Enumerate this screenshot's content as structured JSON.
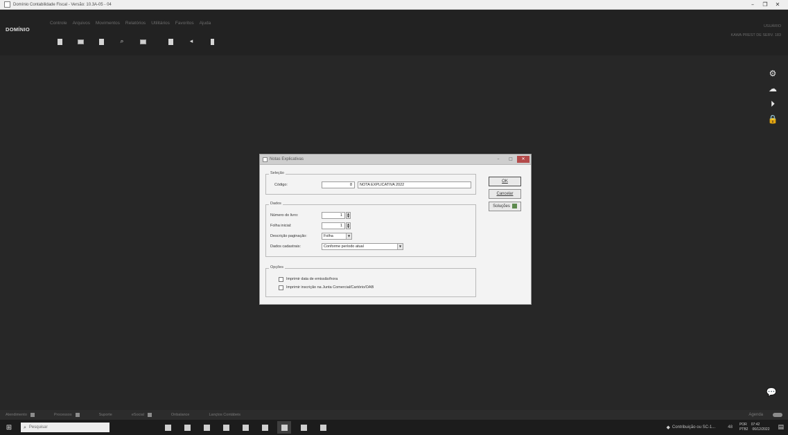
{
  "window": {
    "title": "Domínio Contabilidade Fiscal - Versão: 10.3A-05 - 04",
    "minimize": "–",
    "maximize": "❐",
    "close": "✕"
  },
  "header": {
    "logo": "DOMÍNIO",
    "menu": [
      "Controle",
      "Arquivos",
      "Movimentos",
      "Relatórios",
      "Utilitários",
      "Favoritos",
      "Ajuda"
    ],
    "toolbar_icons": [
      "calculator-icon",
      "copy-icon",
      "book-icon",
      "search-icon",
      "card-icon",
      "calc-icon",
      "back-icon",
      "door-icon"
    ],
    "user_line1": "USUÁRIO",
    "user_line2": "KAWA PREST DE SERV. 183"
  },
  "side_icons": [
    "gear-icon",
    "cloud-icon",
    "play-icon",
    "lock-icon"
  ],
  "side_glyphs": [
    "⚙",
    "☁",
    "⏵",
    "🔒"
  ],
  "chat_glyph": "💬",
  "dialog": {
    "title": "Notas Explicativas",
    "btn_min": "–",
    "btn_max": "□",
    "btn_close": "✕",
    "selecao": {
      "legend": "Seleção",
      "codigo_label": "Código:",
      "codigo_value": "8",
      "descricao_value": "NOTA EXPLICATIVA 2022"
    },
    "dados": {
      "legend": "Dados",
      "livro_label": "Número do livro:",
      "livro_value": "1",
      "folha_label": "Folha inicial:",
      "folha_value": "1",
      "paginacao_label": "Descrição paginação:",
      "paginacao_value": "Folha",
      "cadastrais_label": "Dados cadastrais:",
      "cadastrais_value": "Conforme período atual"
    },
    "opcoes": {
      "legend": "Opções",
      "opt1": "Imprimir data de emissão/hora",
      "opt2": "Imprimir inscrição na Junta Comercial/Cartório/OAB"
    },
    "buttons": {
      "ok": "OK",
      "cancel": "Cancelar",
      "solutions": "Soluções"
    }
  },
  "statusbar": {
    "items": [
      "Atendimento",
      "Processos",
      "Suporte",
      "eSocial",
      "Onbalance",
      "Lançtos Contábeis"
    ],
    "agenda": "Agenda"
  },
  "taskbar": {
    "search_placeholder": "Pesquisar",
    "notification": "Contribuição ou SC-1...",
    "sys": "48",
    "lang": "POR",
    "lang2": "PTB2",
    "time": "07:42",
    "date": "06/12/2022"
  }
}
